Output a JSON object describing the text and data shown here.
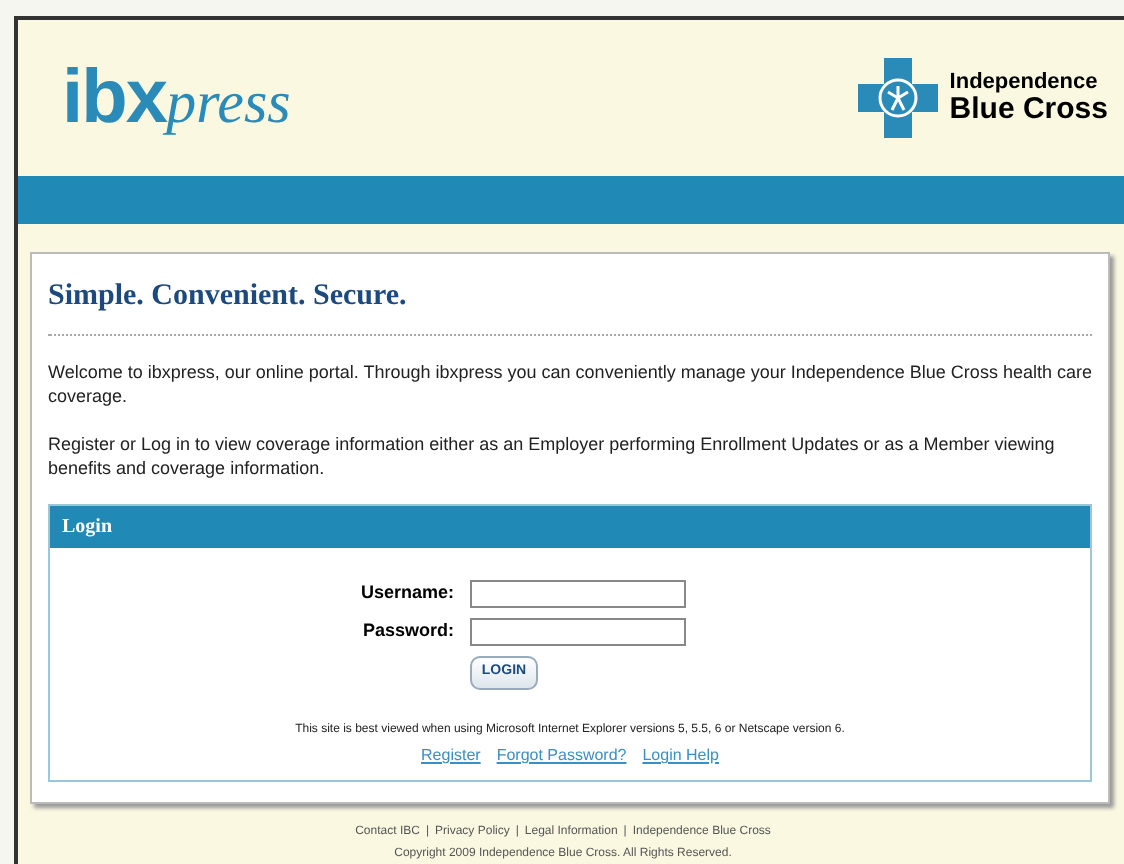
{
  "header": {
    "logo": {
      "bold": "ibx",
      "italic": "press"
    },
    "brand": [
      "Independence",
      "Blue Cross"
    ]
  },
  "intro": {
    "title": "Simple. Convenient. Secure.",
    "paragraphs": [
      "Welcome to ibxpress, our online portal. Through ibxpress you can conveniently manage your Independence Blue Cross health care coverage.",
      "Register or Log in to view coverage information either as an Employer performing Enrollment Updates or as a Member viewing benefits and coverage information."
    ]
  },
  "login": {
    "title": "Login",
    "fields": [
      {
        "label": "Username:"
      },
      {
        "label": "Password:"
      }
    ],
    "button": "LOGIN",
    "note": "This site is best viewed when using Microsoft Internet Explorer versions 5, 5.5, 6 or Netscape version 6.",
    "links": [
      "Register",
      "Forgot Password?",
      "Login Help"
    ]
  },
  "footer": {
    "links": [
      "Contact IBC",
      "Privacy Policy",
      "Legal Information",
      "Independence Blue Cross"
    ],
    "separator": "|",
    "copyright": "Copyright 2009 Independence Blue Cross. All Rights Reserved."
  }
}
